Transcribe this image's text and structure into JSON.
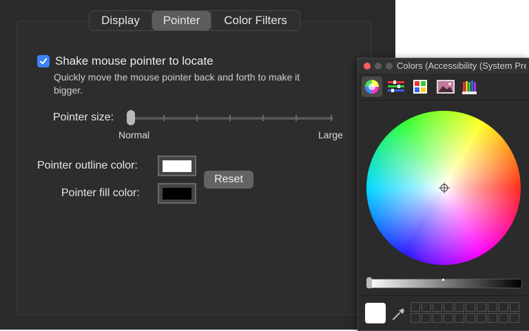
{
  "tabs": [
    {
      "label": "Display"
    },
    {
      "label": "Pointer",
      "selected": true
    },
    {
      "label": "Color Filters"
    }
  ],
  "pointer": {
    "shake_label": "Shake mouse pointer to locate",
    "shake_checked": true,
    "shake_description": "Quickly move the mouse pointer back and forth to make it bigger.",
    "size_label": "Pointer size:",
    "size_min_label": "Normal",
    "size_max_label": "Large",
    "size_value": 0,
    "outline_label": "Pointer outline color:",
    "outline_color": "#ffffff",
    "fill_label": "Pointer fill color:",
    "fill_color": "#000000",
    "reset_label": "Reset"
  },
  "colors_panel": {
    "title": "Colors (Accessibility (System Preferences))",
    "tools": [
      "color-wheel-icon",
      "color-sliders-icon",
      "color-palettes-icon",
      "image-palettes-icon",
      "pencils-icon"
    ],
    "selected_tool": "color-wheel-icon",
    "current_color": "#ffffff",
    "brightness": 1
  },
  "colors": {
    "accent": "#3b82f6",
    "close": "#ff5f57"
  }
}
